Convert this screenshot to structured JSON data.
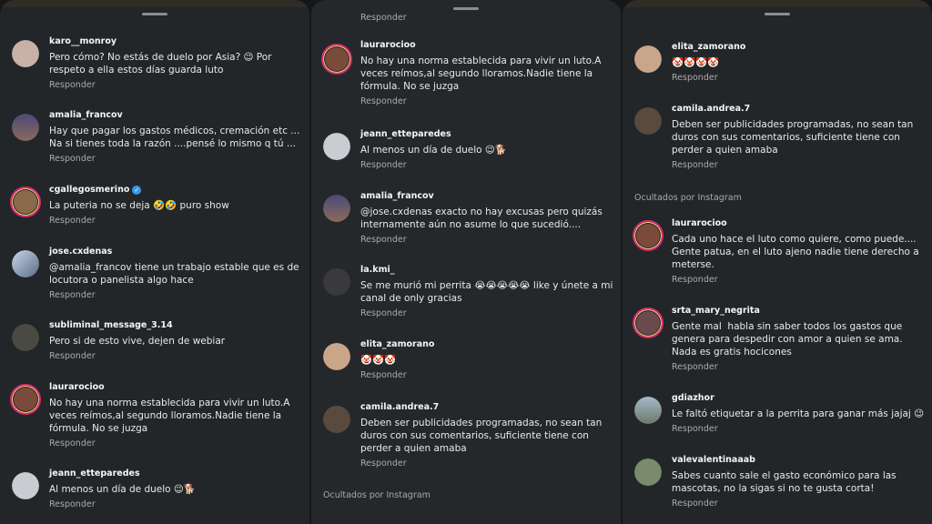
{
  "reply_label": "Responder",
  "hidden_label": "Ocultados por Instagram",
  "panels": {
    "left": {
      "comments": [
        {
          "username": "karo__monroy",
          "text": "Pero cómo? No estás de duelo por Asia? 😉 Por\nrespeto a ella estos días guarda luto",
          "avatar": "#c9b1a8"
        },
        {
          "username": "amalia_francov",
          "text": "Hay que pagar los gastos médicos, cremación etc ...\nNa si tienes toda la razón ....pensé lo mismo q tú ...",
          "avatar": "#6b5a8a"
        },
        {
          "username": "cgallegosmerino",
          "verified": true,
          "text": "La puteria no se deja 🤣🤣 puro show",
          "avatar": "#8a6a4a"
        },
        {
          "username": "jose.cxdenas",
          "text": "@amalia_francov tiene un trabajo estable que es de\nlocutora o panelista algo hace",
          "avatar": "#5b6d8a"
        },
        {
          "username": "subliminal_message_3.14",
          "text": "Pero si de esto vive, dejen de webiar",
          "avatar": "#4a4a42"
        },
        {
          "username": "laurarocioo",
          "text": "No hay una norma establecida para vivir un luto.A\nveces reímos,al segundo lloramos.Nadie tiene la\nfórmula. No se juzga",
          "avatar": "#7a4a3a"
        },
        {
          "username": "jeann_etteparedes",
          "text": "Al menos un día de duelo 😉🐕",
          "avatar": "#c9ccd0"
        }
      ]
    },
    "mid": {
      "comments": [
        {
          "username": "laurarocioo",
          "text": "No hay una norma establecida para vivir un luto.A\nveces reímos,al segundo lloramos.Nadie tiene la\nfórmula. No se juzga",
          "avatar": "#7a4a3a"
        },
        {
          "username": "jeann_etteparedes",
          "text": "Al menos un día de duelo 😉🐕",
          "avatar": "#c9ccd0"
        },
        {
          "username": "amalia_francov",
          "text": "@jose.cxdenas exacto no hay excusas pero quizás\ninternamente aún no asume lo que sucedió....",
          "avatar": "#6b5a8a"
        },
        {
          "username": "la.kmi_",
          "text": "Se me murió mi perrita 😭😭😭😭😭 like y únete a mi\ncanal de only gracias",
          "avatar": "#3a3a3e"
        },
        {
          "username": "elita_zamorano",
          "text": "🤡🤡🤡",
          "avatar": "#c9a58a"
        },
        {
          "username": "camila.andrea.7",
          "text": "Deben ser publicidades programadas, no sean tan\nduros con sus comentarios, suficiente tiene con\nperder a quien amaba",
          "avatar": "#5a4a3e"
        }
      ]
    },
    "right": {
      "comments": [
        {
          "username": "elita_zamorano",
          "text": "🤡🤡🤡🤡",
          "avatar": "#c9a58a"
        },
        {
          "username": "camila.andrea.7",
          "text": "Deben ser publicidades programadas, no sean tan\nduros con sus comentarios, suficiente tiene con\nperder a quien amaba",
          "avatar": "#5a4a3e"
        },
        {
          "username": "laurarocioo",
          "text": "Cada uno hace el luto como quiere, como puede....\nGente patua, en el luto ajeno nadie tiene derecho a\nmeterse.",
          "avatar": "#7a4a3a"
        },
        {
          "username": "srta_mary_negrita",
          "text": "Gente mal  habla sin saber todos los gastos que\ngenera para despedir con amor a quien se ama.\nNada es gratis hocicones",
          "avatar": "#6a4a4e"
        },
        {
          "username": "gdiazhor",
          "text": "Le faltó etiquetar a la perrita para ganar más jajaj 😉",
          "avatar": "#8a9aa8"
        },
        {
          "username": "valevalentinaaab",
          "text": "Sabes cuanto sale el gasto económico para las\nmascotas, no la sigas si no te gusta corta!",
          "avatar": "#7a8a6a"
        }
      ]
    }
  }
}
